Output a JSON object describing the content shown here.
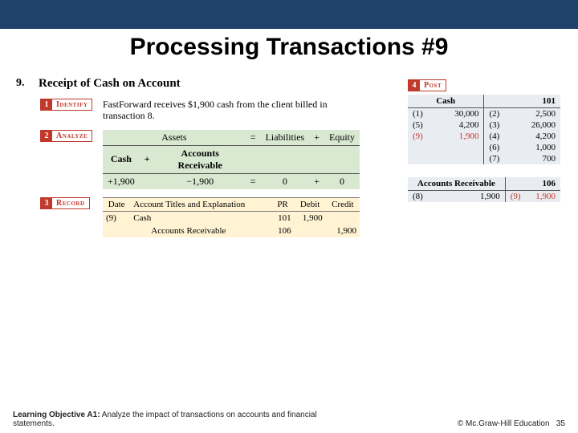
{
  "title": "Processing Transactions #9",
  "tx": {
    "num": "9.",
    "heading": "Receipt of Cash on Account"
  },
  "steps": {
    "s1": {
      "num": "1",
      "label": "Identify"
    },
    "s2": {
      "num": "2",
      "label": "Analyze"
    },
    "s3": {
      "num": "3",
      "label": "Record"
    },
    "s4": {
      "num": "4",
      "label": "Post"
    }
  },
  "identify": "FastForward receives $1,900 cash from the client billed in transaction 8.",
  "analyze": {
    "hdr": {
      "assets": "Assets",
      "eq": "=",
      "liab": "Liabilities",
      "plus": "+",
      "equity": "Equity"
    },
    "sub": {
      "cash": "Cash",
      "plus": "+",
      "ar": "Accounts Receivable"
    },
    "vals": {
      "cash": "+1,900",
      "ar": "−1,900",
      "eq": "=",
      "liab": "0",
      "plus": "+",
      "equity": "0"
    }
  },
  "record": {
    "hdr": {
      "date": "Date",
      "titles": "Account Titles and Explanation",
      "pr": "PR",
      "debit": "Debit",
      "credit": "Credit"
    },
    "r1": {
      "date": "(9)",
      "acct": "Cash",
      "pr": "101",
      "debit": "1,900",
      "credit": ""
    },
    "r2": {
      "date": "",
      "acct": "Accounts Receivable",
      "pr": "106",
      "debit": "",
      "credit": "1,900"
    }
  },
  "post": {
    "cash": {
      "name": "Cash",
      "acctno": "101",
      "rows": [
        {
          "l_lbl": "(1)",
          "l_val": "30,000",
          "r_lbl": "(2)",
          "r_val": "2,500"
        },
        {
          "l_lbl": "(5)",
          "l_val": "4,200",
          "r_lbl": "(3)",
          "r_val": "26,000"
        },
        {
          "l_lbl": "(9)",
          "l_val": "1,900",
          "r_lbl": "(4)",
          "r_val": "4,200",
          "l_red": true
        },
        {
          "l_lbl": "",
          "l_val": "",
          "r_lbl": "(6)",
          "r_val": "1,000"
        },
        {
          "l_lbl": "",
          "l_val": "",
          "r_lbl": "(7)",
          "r_val": "700"
        }
      ]
    },
    "ar": {
      "name": "Accounts Receivable",
      "acctno": "106",
      "rows": [
        {
          "l_lbl": "(8)",
          "l_val": "1,900",
          "r_lbl": "(9)",
          "r_val": "1,900",
          "r_red": true
        }
      ]
    }
  },
  "footer": {
    "lo_label": "Learning Objective A1:",
    "lo_text": " Analyze the impact of transactions on accounts and financial statements.",
    "copyright": "© Mc.Graw-Hill Education",
    "pagenum": "35"
  }
}
